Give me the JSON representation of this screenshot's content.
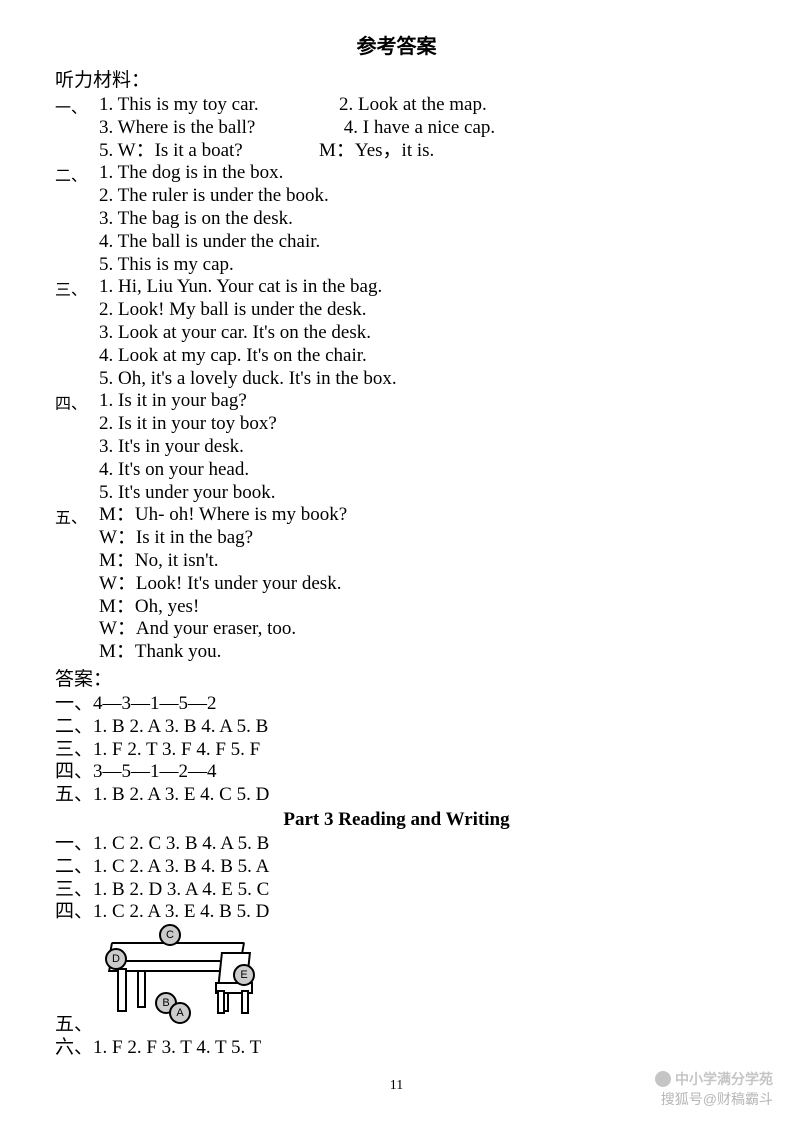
{
  "title": "参考答案",
  "listening_header": "听力材料：",
  "sections": {
    "one": {
      "label": "一、",
      "items": [
        {
          "n": "1.",
          "text": "This is my toy car.",
          "n2": "2.",
          "text2": "Look at the map."
        },
        {
          "n": "3.",
          "text": "Where is the ball?",
          "n2": " 4.",
          "text2": "I have a nice cap."
        },
        {
          "n": "5.",
          "text": "W：Is it a boat?",
          "mid": "M：Yes，it is."
        }
      ]
    },
    "two": {
      "label": "二、",
      "items": [
        "1. The dog is in the box.",
        "2. The ruler is under the book.",
        "3. The bag is on the desk.",
        "4. The ball is under the chair.",
        "5. This is my cap."
      ]
    },
    "three": {
      "label": "三、",
      "items": [
        "1. Hi, Liu Yun. Your cat is in the bag.",
        "2. Look! My ball is under the desk.",
        "3. Look at your car. It's on the desk.",
        "4. Look at my cap. It's on the chair.",
        "5. Oh, it's a lovely duck. It's in the box."
      ]
    },
    "four": {
      "label": "四、",
      "items": [
        "1. Is it in your bag?",
        "2. Is it in your toy box?",
        "3. It's in your desk.",
        "4. It's on your head.",
        "5. It's under your book."
      ]
    },
    "five": {
      "label": "五、",
      "items": [
        "M：Uh- oh! Where is my book?",
        "W：Is it in the bag?",
        "M：No, it isn't.",
        "W：Look! It's under your desk.",
        "M：Oh, yes!",
        "W：And your eraser, too.",
        "M：Thank you."
      ]
    }
  },
  "answers_header": "答案：",
  "answers": [
    {
      "cn": "一、",
      "text": "4—3—1—5—2"
    },
    {
      "cn": "二、",
      "text": "1. B   2. A   3. B   4. A   5. B"
    },
    {
      "cn": "三、",
      "text": "1. F   2. T   3. F   4. F   5. F"
    },
    {
      "cn": "四、",
      "text": "3—5—1—2—4"
    },
    {
      "cn": "五、",
      "text": "1. B   2. A   3. E   4. C   5. D"
    }
  ],
  "part3_title": "Part 3    Reading and Writing",
  "part3_answers": [
    {
      "cn": "一、",
      "text": "1. C   2. C   3. B   4. A   5. B"
    },
    {
      "cn": "二、",
      "text": "1. C   2. A   3. B   4. B   5. A"
    },
    {
      "cn": "三、",
      "text": "1. B   2. D   3. A   4. E   5. C"
    },
    {
      "cn": "四、",
      "text": "1. C   2. A   3. E   4. B   5. D"
    }
  ],
  "section_five_label": "五、",
  "illustration_labels": {
    "C": "C",
    "D": "D",
    "B": "B",
    "A": "A",
    "E": "E"
  },
  "section_six": {
    "cn": "六、",
    "text": "1. F   2. F   3. T   4. T   5. T"
  },
  "page_number": "11",
  "watermark": {
    "line1": "中小学满分学苑",
    "line2": "搜狐号@财稿霸斗"
  }
}
